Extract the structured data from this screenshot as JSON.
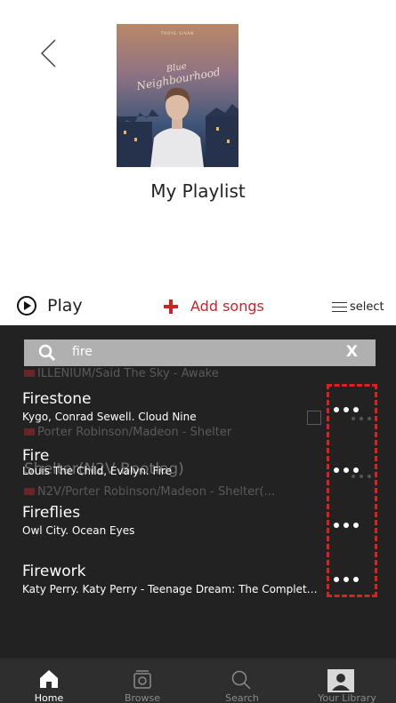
{
  "header": {
    "playlist_title": "My Playlist",
    "cover_label": "TROYE SIVAN",
    "cover_title_line1": "Blue",
    "cover_title_line2": "Neighbourhood"
  },
  "actions": {
    "play_label": "Play",
    "add_label": "Add songs",
    "select_label": "select"
  },
  "search": {
    "query": "fire",
    "clear_label": "X"
  },
  "songs": [
    {
      "title": "Firestone",
      "subtitle": "Kygo, Conrad Sewell. Cloud Nine"
    },
    {
      "title": "Fire",
      "subtitle": "Louis The Child, Evalyn. Fire"
    },
    {
      "title": "Fireflies",
      "subtitle": "Owl City. Ocean Eyes"
    },
    {
      "title": "Firework",
      "subtitle": "Katy Perry. Katy Perry - Teenage Dream: The Complete Confection"
    }
  ],
  "background_list": {
    "row1": "ILLENIUM/Said The Sky - Awake",
    "row2": "Porter Robinson/Madeon - Shelter",
    "row3_title": "Shelter(N2V Bootleg)",
    "row3_sub": "N2V/Porter Robinson/Madeon - Shelter(..."
  },
  "tabs": [
    {
      "label": "Home",
      "icon": "home-icon",
      "active": true
    },
    {
      "label": "Browse",
      "icon": "browse-icon",
      "active": false
    },
    {
      "label": "Search",
      "icon": "search-icon",
      "active": false
    },
    {
      "label": "Your Library",
      "icon": "library-icon",
      "active": false
    }
  ],
  "colors": {
    "accent_red": "#d12020",
    "dark_panel": "#222222",
    "tabbar": "#2e2e2e"
  }
}
